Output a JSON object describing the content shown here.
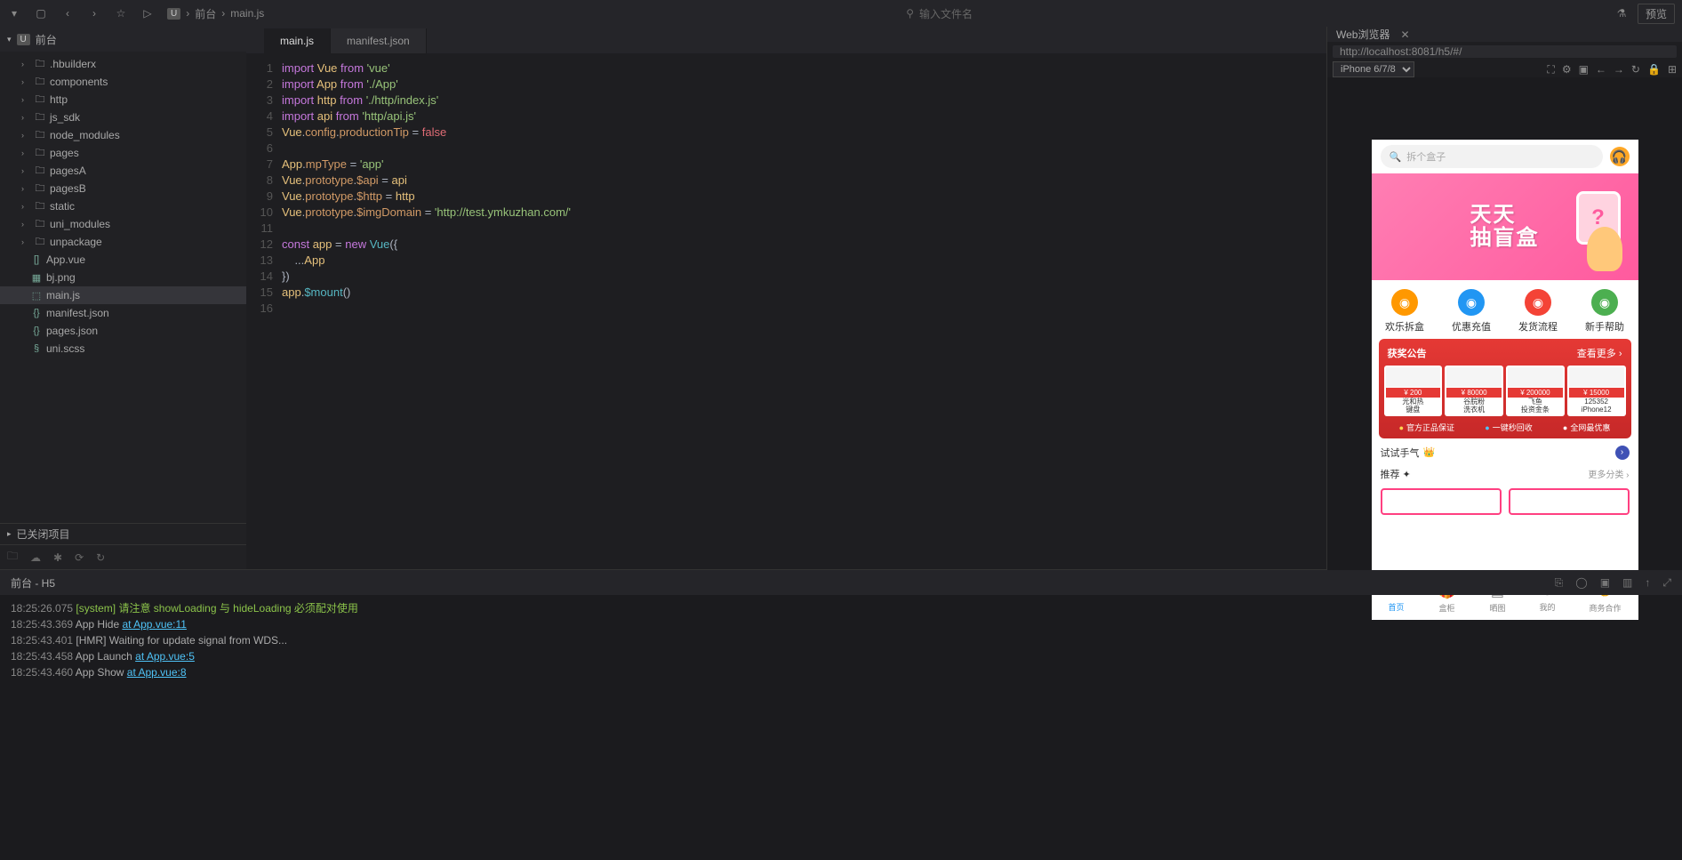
{
  "topbar": {
    "crumb_badge": "U",
    "crumb1": "前台",
    "crumb2": "main.js",
    "search_placeholder": "输入文件名",
    "preview_btn": "预览"
  },
  "sidebar": {
    "project_badge": "U",
    "project_name": "前台",
    "folders": [
      ".hbuilderx",
      "components",
      "http",
      "js_sdk",
      "node_modules",
      "pages",
      "pagesA",
      "pagesB",
      "static",
      "uni_modules",
      "unpackage"
    ],
    "files": [
      "App.vue",
      "bj.png",
      "main.js",
      "manifest.json",
      "pages.json",
      "uni.scss"
    ],
    "closed_projects": "已关闭项目"
  },
  "tabs": [
    {
      "label": "main.js",
      "active": true
    },
    {
      "label": "manifest.json",
      "active": false
    }
  ],
  "code_lines": [
    [
      [
        "kw",
        "import"
      ],
      [
        "op",
        " "
      ],
      [
        "vn",
        "Vue"
      ],
      [
        "op",
        " "
      ],
      [
        "kw",
        "from"
      ],
      [
        "op",
        " "
      ],
      [
        "str",
        "'vue'"
      ]
    ],
    [
      [
        "kw",
        "import"
      ],
      [
        "op",
        " "
      ],
      [
        "vn",
        "App"
      ],
      [
        "op",
        " "
      ],
      [
        "kw",
        "from"
      ],
      [
        "op",
        " "
      ],
      [
        "str",
        "'./App'"
      ]
    ],
    [
      [
        "kw",
        "import"
      ],
      [
        "op",
        " "
      ],
      [
        "vn",
        "http"
      ],
      [
        "op",
        " "
      ],
      [
        "kw",
        "from"
      ],
      [
        "op",
        " "
      ],
      [
        "str",
        "'./http/index.js'"
      ]
    ],
    [
      [
        "kw",
        "import"
      ],
      [
        "op",
        " "
      ],
      [
        "vn",
        "api"
      ],
      [
        "op",
        " "
      ],
      [
        "kw",
        "from"
      ],
      [
        "op",
        " "
      ],
      [
        "str",
        "'http/api.js'"
      ]
    ],
    [
      [
        "vn",
        "Vue"
      ],
      [
        "op",
        "."
      ],
      [
        "prop",
        "config"
      ],
      [
        "op",
        "."
      ],
      [
        "prop",
        "productionTip"
      ],
      [
        "op",
        " = "
      ],
      [
        "bool",
        "false"
      ]
    ],
    [],
    [
      [
        "vn",
        "App"
      ],
      [
        "op",
        "."
      ],
      [
        "prop",
        "mpType"
      ],
      [
        "op",
        " = "
      ],
      [
        "str",
        "'app'"
      ]
    ],
    [
      [
        "vn",
        "Vue"
      ],
      [
        "op",
        "."
      ],
      [
        "prop",
        "prototype"
      ],
      [
        "op",
        "."
      ],
      [
        "prop",
        "$api"
      ],
      [
        "op",
        " = "
      ],
      [
        "vn",
        "api"
      ]
    ],
    [
      [
        "vn",
        "Vue"
      ],
      [
        "op",
        "."
      ],
      [
        "prop",
        "prototype"
      ],
      [
        "op",
        "."
      ],
      [
        "prop",
        "$http"
      ],
      [
        "op",
        " = "
      ],
      [
        "vn",
        "http"
      ]
    ],
    [
      [
        "vn",
        "Vue"
      ],
      [
        "op",
        "."
      ],
      [
        "prop",
        "prototype"
      ],
      [
        "op",
        "."
      ],
      [
        "prop",
        "$imgDomain"
      ],
      [
        "op",
        " = "
      ],
      [
        "str",
        "'http://test.ymkuzhan.com/'"
      ]
    ],
    [],
    [
      [
        "kw",
        "const"
      ],
      [
        "op",
        " "
      ],
      [
        "vn",
        "app"
      ],
      [
        "op",
        " = "
      ],
      [
        "kw",
        "new"
      ],
      [
        "op",
        " "
      ],
      [
        "fn",
        "Vue"
      ],
      [
        "op",
        "({"
      ]
    ],
    [
      [
        "op",
        "    ..."
      ],
      [
        "vn",
        "App"
      ]
    ],
    [
      [
        "op",
        "})"
      ]
    ],
    [
      [
        "vn",
        "app"
      ],
      [
        "op",
        "."
      ],
      [
        "fn",
        "$mount"
      ],
      [
        "op",
        "()"
      ]
    ],
    []
  ],
  "browser": {
    "title": "Web浏览器",
    "url": "http://localhost:8081/h5/#/",
    "device": "iPhone 6/7/8"
  },
  "phone": {
    "search_ph": "拆个盒子",
    "banner_l1": "天天",
    "banner_l2": "抽盲盒",
    "grid": [
      {
        "label": "欢乐拆盒",
        "color": "#ff9800"
      },
      {
        "label": "优惠充值",
        "color": "#2196f3"
      },
      {
        "label": "发货流程",
        "color": "#f44336"
      },
      {
        "label": "新手帮助",
        "color": "#4caf50"
      }
    ],
    "award_title": "获奖公告",
    "award_more": "查看更多 ›",
    "awards": [
      {
        "price": "¥ 200",
        "n1": "光和热",
        "n2": "键盘"
      },
      {
        "price": "¥ 80000",
        "n1": "谷脘粉",
        "n2": "洗衣机"
      },
      {
        "price": "¥ 200000",
        "n1": "飞鱼",
        "n2": "投资金条"
      },
      {
        "price": "¥ 15000",
        "n1": "125352",
        "n2": "iPhone12"
      }
    ],
    "award_foot": [
      "官方正品保证",
      "一键秒回收",
      "全网最优惠"
    ],
    "luck": "试试手气",
    "rec": "推荐",
    "rec_more": "更多分类 ›",
    "tabs": [
      {
        "label": "首页",
        "icon": "⌂",
        "active": true
      },
      {
        "label": "盒柜",
        "icon": "🎁",
        "active": false
      },
      {
        "label": "晒图",
        "icon": "▤",
        "active": false
      },
      {
        "label": "我的",
        "icon": "☺",
        "active": false
      },
      {
        "label": "商务合作",
        "icon": "🤝",
        "active": false
      }
    ]
  },
  "console": {
    "title": "前台 - H5",
    "lines": [
      {
        "ts": "18:25:26.075",
        "tag": "[system]",
        "tag_cls": "sys",
        "msg": "请注意 showLoading 与 hideLoading 必须配对使用",
        "link": ""
      },
      {
        "ts": "18:25:43.369",
        "tag": "",
        "tag_cls": "",
        "msg": "App Hide ",
        "link": "at App.vue:11"
      },
      {
        "ts": "18:25:43.401",
        "tag": "",
        "tag_cls": "",
        "msg": "[HMR] Waiting for update signal from WDS...",
        "link": ""
      },
      {
        "ts": "18:25:43.458",
        "tag": "",
        "tag_cls": "",
        "msg": "App Launch ",
        "link": "at App.vue:5"
      },
      {
        "ts": "18:25:43.460",
        "tag": "",
        "tag_cls": "",
        "msg": "App Show ",
        "link": "at App.vue:8"
      }
    ]
  }
}
